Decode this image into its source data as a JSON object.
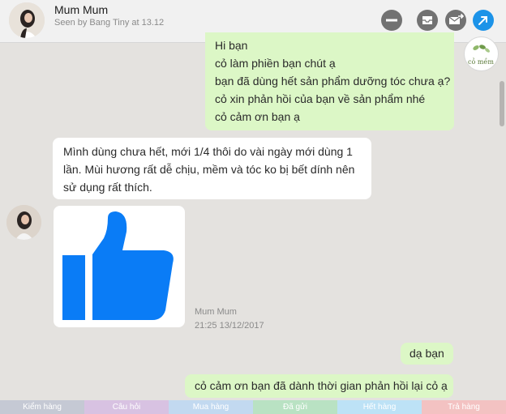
{
  "header": {
    "name": "Mum Mum",
    "seen": "Seen by Bang Tiny at 13.12",
    "buttons": [
      "remove-icon",
      "archive-icon",
      "forward-mail-icon",
      "open-external-icon"
    ]
  },
  "messages": {
    "m1": [
      "Hi bạn",
      "cỏ làm phiền bạn chút ạ",
      "bạn đã dùng hết sản phẩm dưỡng tóc chưa ạ?",
      "cỏ xin phản hồi của bạn về sản phẩm nhé",
      "cỏ cảm ơn bạn ạ"
    ],
    "m2": [
      "Mình dùng chưa hết, mới 1/4 thôi do vài ngày mới dùng 1",
      "lần. Mùi hương rất dễ chịu, mềm và tóc ko bị bết dính nên",
      "sử dụng rất thích."
    ],
    "m3": "dạ bạn",
    "m4": "cỏ cảm ơn bạn đã dành thời gian phản hồi lại cỏ ạ"
  },
  "shop_logo_text": "cỏ mềm",
  "sticker": {
    "icon": "thumbs-up-icon",
    "color": "#0a7cf6"
  },
  "meta": {
    "name": "Mum Mum",
    "time": "21:25 13/12/2017"
  },
  "labels": [
    {
      "text": "Kiểm hàng",
      "color": "#c5c9d4"
    },
    {
      "text": "Câu hỏi",
      "color": "#d8c2e2"
    },
    {
      "text": "Mua hàng",
      "color": "#c2d9f0"
    },
    {
      "text": "Đã gửi",
      "color": "#b9e2c3"
    },
    {
      "text": "Hết hàng",
      "color": "#bde2f6"
    },
    {
      "text": "Trả hàng",
      "color": "#f3c2c2"
    }
  ]
}
